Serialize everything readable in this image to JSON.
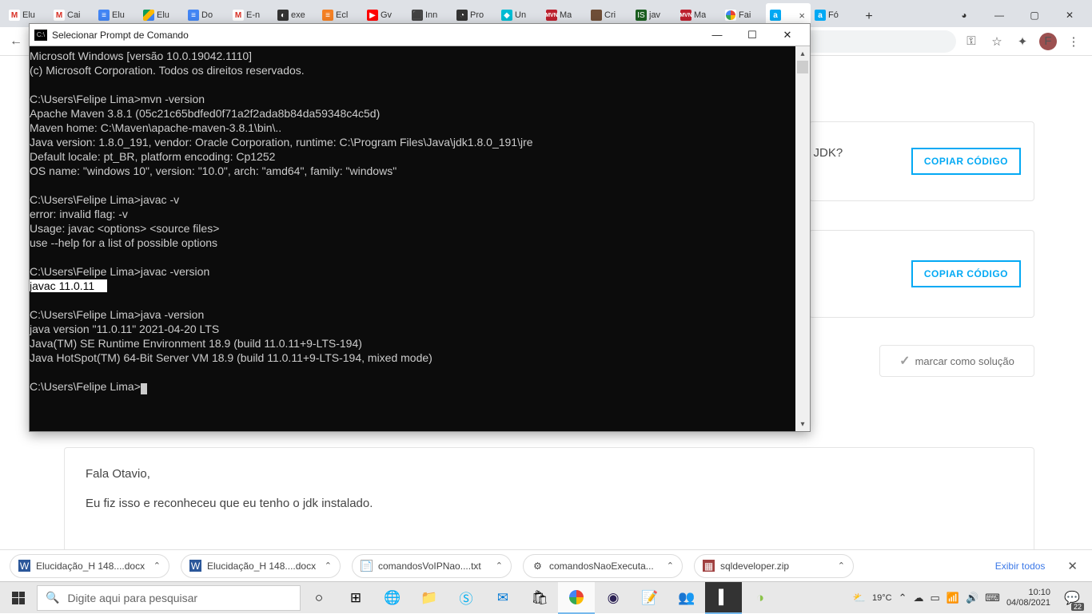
{
  "tabs": [
    {
      "label": "Elu"
    },
    {
      "label": "Cai"
    },
    {
      "label": "Elu"
    },
    {
      "label": "Elu"
    },
    {
      "label": "Do"
    },
    {
      "label": "E-n"
    },
    {
      "label": "exe"
    },
    {
      "label": "Ecl"
    },
    {
      "label": "Gv"
    },
    {
      "label": "Inn"
    },
    {
      "label": "Pro"
    },
    {
      "label": "Un"
    },
    {
      "label": "Ma"
    },
    {
      "label": "Cri"
    },
    {
      "label": "jav"
    },
    {
      "label": "Ma"
    },
    {
      "label": "Fai"
    },
    {
      "label": ""
    },
    {
      "label": "Fó"
    }
  ],
  "avatar_letter": "F",
  "page": {
    "jdk_tail": "a JDK?",
    "copy_label": "COPIAR CÓDIGO",
    "mark_solution": "marcar como solução",
    "reply_line1": "Fala Otavio,",
    "reply_line2": "Eu fiz isso e reconheceu que eu tenho o jdk instalado."
  },
  "cmd": {
    "title": "Selecionar Prompt de Comando",
    "lines": {
      "l1": "Microsoft Windows [versão 10.0.19042.1110]",
      "l2": "(c) Microsoft Corporation. Todos os direitos reservados.",
      "l3": "",
      "l4": "C:\\Users\\Felipe Lima>mvn -version",
      "l5": "Apache Maven 3.8.1 (05c21c65bdfed0f71a2f2ada8b84da59348c4c5d)",
      "l6": "Maven home: C:\\Maven\\apache-maven-3.8.1\\bin\\..",
      "l7": "Java version: 1.8.0_191, vendor: Oracle Corporation, runtime: C:\\Program Files\\Java\\jdk1.8.0_191\\jre",
      "l8": "Default locale: pt_BR, platform encoding: Cp1252",
      "l9": "OS name: \"windows 10\", version: \"10.0\", arch: \"amd64\", family: \"windows\"",
      "l10": "",
      "l11": "C:\\Users\\Felipe Lima>javac -v",
      "l12": "error: invalid flag: -v",
      "l13": "Usage: javac <options> <source files>",
      "l14": "use --help for a list of possible options",
      "l15": "",
      "l16": "C:\\Users\\Felipe Lima>javac -version",
      "l17": "javac 11.0.11",
      "l17pad": "    ",
      "l18": "",
      "l19": "C:\\Users\\Felipe Lima>java -version",
      "l20": "java version \"11.0.11\" 2021-04-20 LTS",
      "l21": "Java(TM) SE Runtime Environment 18.9 (build 11.0.11+9-LTS-194)",
      "l22": "Java HotSpot(TM) 64-Bit Server VM 18.9 (build 11.0.11+9-LTS-194, mixed mode)",
      "l23": "",
      "l24": "C:\\Users\\Felipe Lima>"
    }
  },
  "downloads": {
    "items": [
      {
        "name": "Elucidação_H 148....docx",
        "kind": "docx"
      },
      {
        "name": "Elucidação_H 148....docx",
        "kind": "docx"
      },
      {
        "name": "comandosVoIPNao....txt",
        "kind": "txt"
      },
      {
        "name": "comandosNaoExecuta...",
        "kind": "bat"
      },
      {
        "name": "sqldeveloper.zip",
        "kind": "zip"
      }
    ],
    "showall": "Exibir todos"
  },
  "taskbar": {
    "search_placeholder": "Digite aqui para pesquisar",
    "weather": "19°C",
    "time": "10:10",
    "date": "04/08/2021",
    "notif_count": "22"
  }
}
